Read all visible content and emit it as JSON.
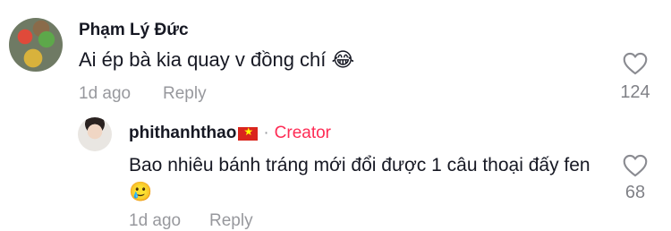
{
  "comment": {
    "username": "Phạm Lý Đức",
    "text": "Ai ép bà kia quay v đồng chí 😂",
    "date": "1d ago",
    "reply_label": "Reply",
    "like_count": "124"
  },
  "reply": {
    "username": "phithanhthao",
    "flag": "Vietnam flag",
    "separator": "·",
    "badge": "Creator",
    "text": "Bao nhiêu bánh tráng mới đổi được 1 câu thoại đấy fen 🥲",
    "date": "1d ago",
    "reply_label": "Reply",
    "like_count": "68"
  },
  "colors": {
    "creator": "#fe2c55",
    "text": "#161823",
    "muted": "rgba(22,24,35,0.45)"
  },
  "icons": {
    "like": "heart-outline-icon"
  }
}
